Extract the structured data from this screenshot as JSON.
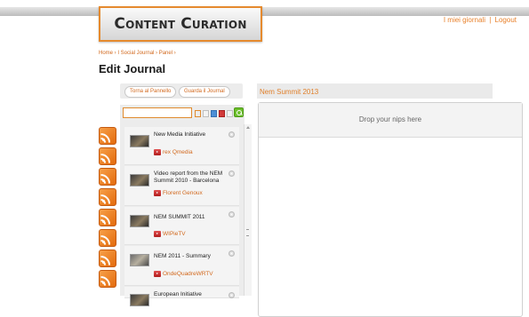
{
  "header": {
    "logo_text": "Content Curation",
    "user_links": {
      "my_journals": "I miei giornali",
      "separator": "|",
      "logout": "Logout"
    }
  },
  "breadcrumb": "Home › I Social Journal › Panel ›",
  "page_title": "Edit Journal",
  "left_panel": {
    "back_button": "Torna al Pannello",
    "view_button": "Guarda il Journal",
    "search_value": "",
    "items": [
      {
        "title": "New Media Initiative",
        "source": "rex Qmedia"
      },
      {
        "title": "Video report from the NEM Summit 2010 - Barcelona",
        "source": "Florent Genoux"
      },
      {
        "title": "NEM SUMMIT 2011",
        "source": "WIPieTV"
      },
      {
        "title": "NEM 2011 - Summary",
        "source": "OndeQuadreWRTV"
      },
      {
        "title": "European Initiative",
        "source": ""
      }
    ]
  },
  "right_panel": {
    "journal_name": "Nem Summit 2013",
    "drop_hint": "Drop your nips here"
  },
  "icons": {
    "feed": "rss-feed-icon",
    "search": "search-go-icon",
    "remove": "close-icon",
    "source": "youtube-icon"
  },
  "colors": {
    "accent": "#e8812b",
    "rss": "#f08a24",
    "search_button": "#6cbf2b"
  }
}
